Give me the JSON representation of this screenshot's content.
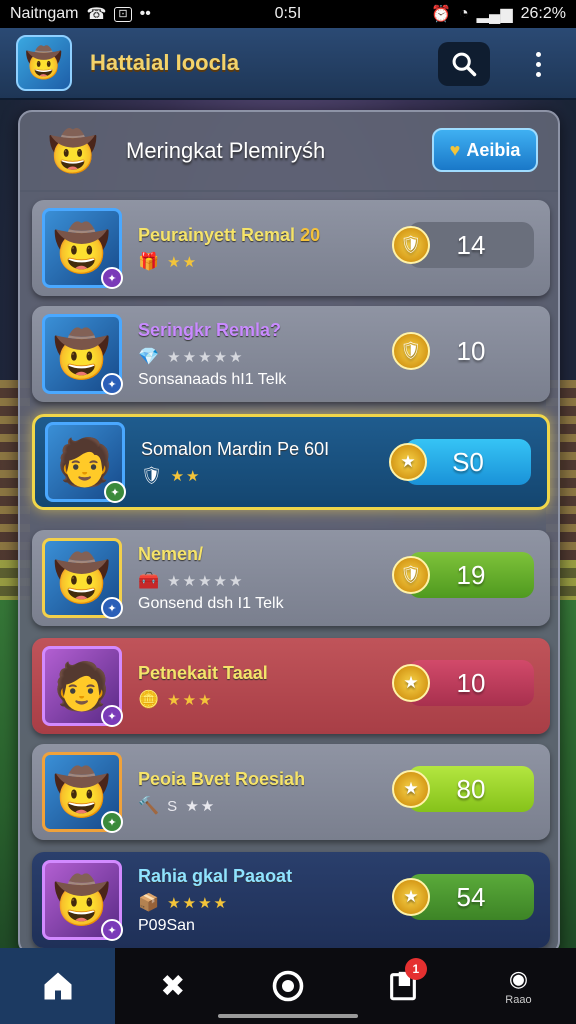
{
  "status_bar": {
    "carrier": "Naitngam",
    "extra_icon": "☎",
    "box_icon": "⊡",
    "time": "0:5I",
    "battery": "26:2%"
  },
  "header": {
    "title": "Hattaial Ioocla",
    "app_icon": "cowboy-avatar-icon",
    "search_icon": "search-icon",
    "more_icon": "more-vert-icon"
  },
  "panel": {
    "title": "Meringkat Plemiryśh",
    "button_label": "Aeibia",
    "button_icon": "heart-icon"
  },
  "rows": [
    {
      "name": "Peurainyett Remal",
      "name_num": "20",
      "stars": "★★",
      "sub": "",
      "score": "14",
      "color": "#8f94a3"
    },
    {
      "name": "Seringkr Remla?",
      "name_num": "",
      "stars": "★★★★★",
      "sub": "Sonsanaads hI1 Telk",
      "score": "10",
      "color": "#8f94a3"
    },
    {
      "name": "Somalon Mardin Pe 60I",
      "name_num": "",
      "stars": "★★",
      "sub": "",
      "score": "S0",
      "color": "#1f5c8e"
    },
    {
      "name": "Nemen/",
      "name_num": "",
      "stars": "★★★★★",
      "sub": "Gonsend dsh I1 Telk",
      "score": "19",
      "color": "#8f94a3"
    },
    {
      "name": "Petnekait Taaal",
      "name_num": "",
      "stars": "★★★",
      "sub": "",
      "score": "10",
      "color": "#c0545a"
    },
    {
      "name": "Peoia Bvet Roesiah",
      "name_num": "",
      "stars": "S ★★",
      "sub": "",
      "score": "80",
      "color": "#8f94a3"
    },
    {
      "name": "Rahia gkal Paaoat",
      "name_num": "",
      "stars": "★★★★",
      "sub": "P09San",
      "score": "54",
      "color": "#2a3f6c"
    }
  ],
  "nav": {
    "home": "home-icon",
    "games": "shuffle-icon",
    "record": "record-icon",
    "inbox": "inbox-icon",
    "inbox_badge": "1",
    "profile_label": "Raao"
  }
}
